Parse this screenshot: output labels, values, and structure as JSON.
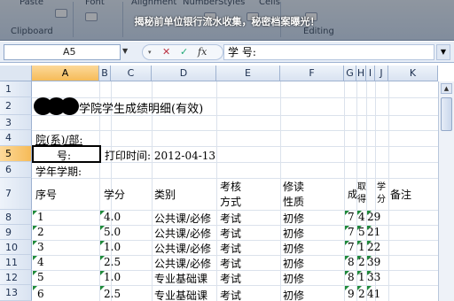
{
  "ribbon": {
    "groups": [
      "Paste",
      "Font",
      "Alignment",
      "Number",
      "Styles",
      "Cells"
    ],
    "clipboard_label": "Clipboard",
    "editing_label": "Editing"
  },
  "headline": "揭秘前单位银行流水收集，秘密档案曝光！",
  "formula_bar": {
    "name_box": "A5",
    "formula": "学 号:",
    "icons": [
      "dropdown-icon",
      "cancel-icon",
      "enter-icon",
      "function-icon"
    ]
  },
  "columns": [
    "A",
    "B",
    "C",
    "D",
    "E",
    "F",
    "G",
    "H",
    "I",
    "J",
    "K"
  ],
  "selected_column": "A",
  "rows": [
    "1",
    "2",
    "3",
    "4",
    "5",
    "6",
    "7",
    "8",
    "9",
    "10",
    "11",
    "12",
    "13"
  ],
  "selected_row": "5",
  "sheet": {
    "title_suffix": "学院学生成绩明细(有效)",
    "dept_label": "院(系)/部:",
    "student_id_label": "号:",
    "print_time": "打印时间: 2012-04-13",
    "year_term": "学年学期:",
    "headers": {
      "seq": "序号",
      "credit": "学分",
      "category": "类别",
      "exam_mode_1": "考核",
      "exam_mode_2": "方式",
      "nature_1": "修读",
      "nature_2": "性质",
      "score": "成",
      "obtain": "取",
      "obtain_2": "得",
      "gpa": "学",
      "gpa_2": "分",
      "remark": "备注"
    },
    "records": [
      {
        "seq": "1",
        "credit": "4.0",
        "category": "公共课/必修",
        "exam": "考试",
        "nature": "初修",
        "g": "7",
        "h": "4",
        "i": "29"
      },
      {
        "seq": "2",
        "credit": "5.0",
        "category": "公共课/必修",
        "exam": "考试",
        "nature": "初修",
        "g": "7",
        "h": "5",
        "i": "21"
      },
      {
        "seq": "3",
        "credit": "1.0",
        "category": "公共课/必修",
        "exam": "考试",
        "nature": "初修",
        "g": "7",
        "h": "1",
        "i": "22"
      },
      {
        "seq": "4",
        "credit": "2.5",
        "category": "公共课/必修",
        "exam": "考试",
        "nature": "初修",
        "g": "8",
        "h": "2",
        "i": "39"
      },
      {
        "seq": "5",
        "credit": "1.0",
        "category": "专业基础课",
        "exam": "考试",
        "nature": "初修",
        "g": "8",
        "h": "1",
        "i": "33"
      },
      {
        "seq": "6",
        "credit": "2.5",
        "category": "专业基础课",
        "exam": "考试",
        "nature": "初修",
        "g": "9",
        "h": "2",
        "i": "41"
      }
    ]
  },
  "colors": {
    "selected_header": "#f6bb58",
    "overlay": "rgba(0,0,0,0.34)",
    "error_triangle": "#1f8a3a"
  }
}
